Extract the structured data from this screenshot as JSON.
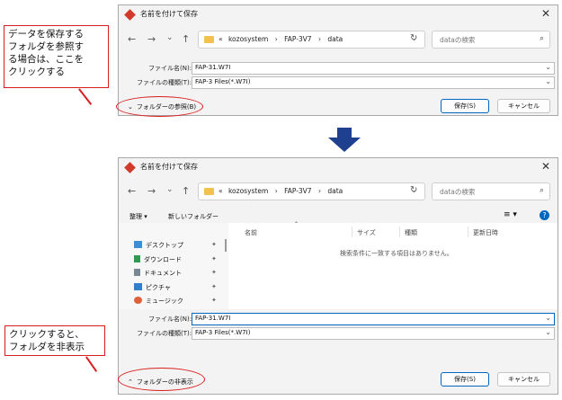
{
  "dialog_top": {
    "title": "名前を付けて保存",
    "address": {
      "prefix": "«",
      "path": [
        "kozosystem",
        "FAP-3V7",
        "data"
      ],
      "sep": "›"
    },
    "search_placeholder": "dataの検索",
    "filename_label": "ファイル名(N):",
    "filename_value": "FAP-31.W7I",
    "filetype_label": "ファイルの種類(T):",
    "filetype_value": "FAP-3 Files(*.W7I)",
    "browse_toggle": "フォルダーの参照(B)",
    "save_button": "保存(S)",
    "cancel_button": "キャンセル"
  },
  "dialog_bottom": {
    "title": "名前を付けて保存",
    "address": {
      "prefix": "«",
      "path": [
        "kozosystem",
        "FAP-3V7",
        "data"
      ],
      "sep": "›"
    },
    "search_placeholder": "dataの検索",
    "commands": {
      "organize": "整理 ▾",
      "new_folder": "新しいフォルダー"
    },
    "sidebar": [
      {
        "label": "デスクトップ",
        "icon": "desktop-icon",
        "color": "#3a8fd8"
      },
      {
        "label": "ダウンロード",
        "icon": "download-icon",
        "color": "#2c9c52"
      },
      {
        "label": "ドキュメント",
        "icon": "document-icon",
        "color": "#7a8896"
      },
      {
        "label": "ピクチャ",
        "icon": "picture-icon",
        "color": "#2f7fcf"
      },
      {
        "label": "ミュージック",
        "icon": "music-icon",
        "color": "#e0603a"
      }
    ],
    "columns": [
      "名前",
      "サイズ",
      "種類",
      "更新日時"
    ],
    "empty_message": "検索条件に一致する項目はありません。",
    "filename_label": "ファイル名(N):",
    "filename_value": "FAP-31.W7I",
    "filetype_label": "ファイルの種類(T):",
    "filetype_value": "FAP-3 Files(*.W7I)",
    "hide_toggle": "フォルダーの非表示",
    "save_button": "保存(S)",
    "cancel_button": "キャンセル"
  },
  "callouts": {
    "top": [
      "データを保存する",
      "フォルダを参照す",
      "る場合は、ここを",
      "クリックする"
    ],
    "bottom": [
      "クリックすると、",
      "フォルダを非表示"
    ]
  },
  "colors": {
    "accent": "#0067c0",
    "annotation": "#d91e1e",
    "arrow": "#1f3f8f"
  }
}
